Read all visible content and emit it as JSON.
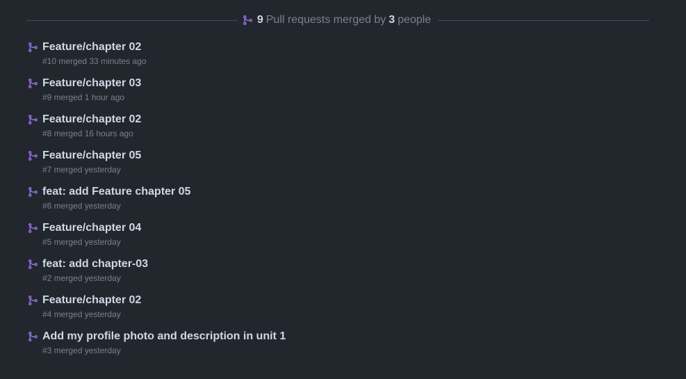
{
  "summary": {
    "pr_count": "9",
    "text_middle": "Pull requests merged by",
    "people_count": "3",
    "text_end": "people"
  },
  "colors": {
    "merged_icon": "#986ee2",
    "title": "#cdd9e5",
    "muted": "#768390",
    "background": "#22272e"
  },
  "pull_requests": [
    {
      "title": "Feature/chapter 02",
      "meta": "#10 merged 33 minutes ago",
      "icon": "git-merge-icon"
    },
    {
      "title": "Feature/chapter 03",
      "meta": "#9 merged 1 hour ago",
      "icon": "git-merge-icon"
    },
    {
      "title": "Feature/chapter 02",
      "meta": "#8 merged 16 hours ago",
      "icon": "git-merge-icon"
    },
    {
      "title": "Feature/chapter 05",
      "meta": "#7 merged yesterday",
      "icon": "git-merge-icon"
    },
    {
      "title": "feat: add Feature chapter 05",
      "meta": "#6 merged yesterday",
      "icon": "git-merge-icon"
    },
    {
      "title": "Feature/chapter 04",
      "meta": "#5 merged yesterday",
      "icon": "git-merge-icon"
    },
    {
      "title": "feat: add chapter-03",
      "meta": "#2 merged yesterday",
      "icon": "git-merge-icon"
    },
    {
      "title": "Feature/chapter 02",
      "meta": "#4 merged yesterday",
      "icon": "git-merge-icon"
    },
    {
      "title": "Add my profile photo and description in unit 1",
      "meta": "#3 merged yesterday",
      "icon": "git-merge-icon"
    }
  ]
}
